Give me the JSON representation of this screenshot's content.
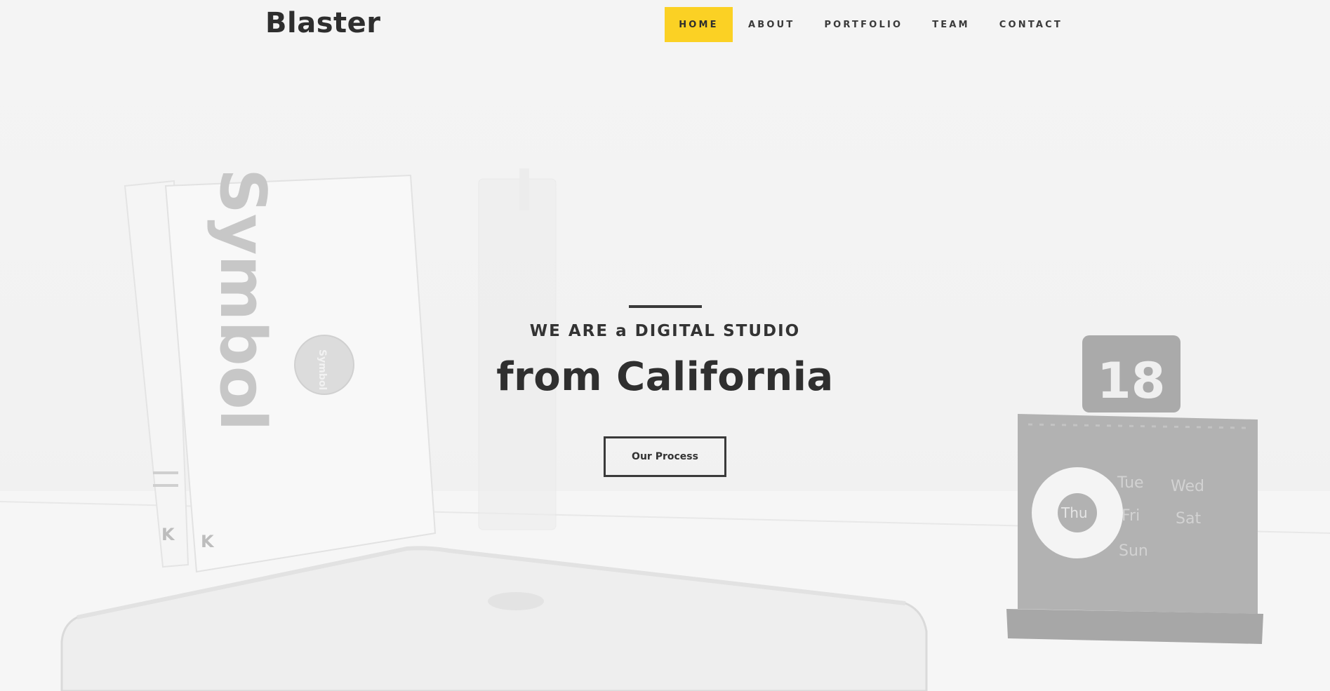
{
  "header": {
    "logo": "Blaster",
    "nav": [
      {
        "label": "HOME",
        "active": true
      },
      {
        "label": "ABOUT",
        "active": false
      },
      {
        "label": "PORTFOLIO",
        "active": false
      },
      {
        "label": "TEAM",
        "active": false
      },
      {
        "label": "CONTACT",
        "active": false
      }
    ]
  },
  "hero": {
    "subtitle": "WE ARE a DIGITAL STUDIO",
    "title": "from California",
    "button_label": "Our Process"
  },
  "background": {
    "book_spine_text": "Symbol",
    "book_circle_text": "Symbol",
    "calendar_number": "18",
    "calendar_days": [
      "Tue",
      "Wed",
      "Thu",
      "Fri",
      "Sat",
      "Sun"
    ]
  },
  "colors": {
    "accent": "#fbd124",
    "text": "#333333",
    "background": "#f3f3f3"
  }
}
